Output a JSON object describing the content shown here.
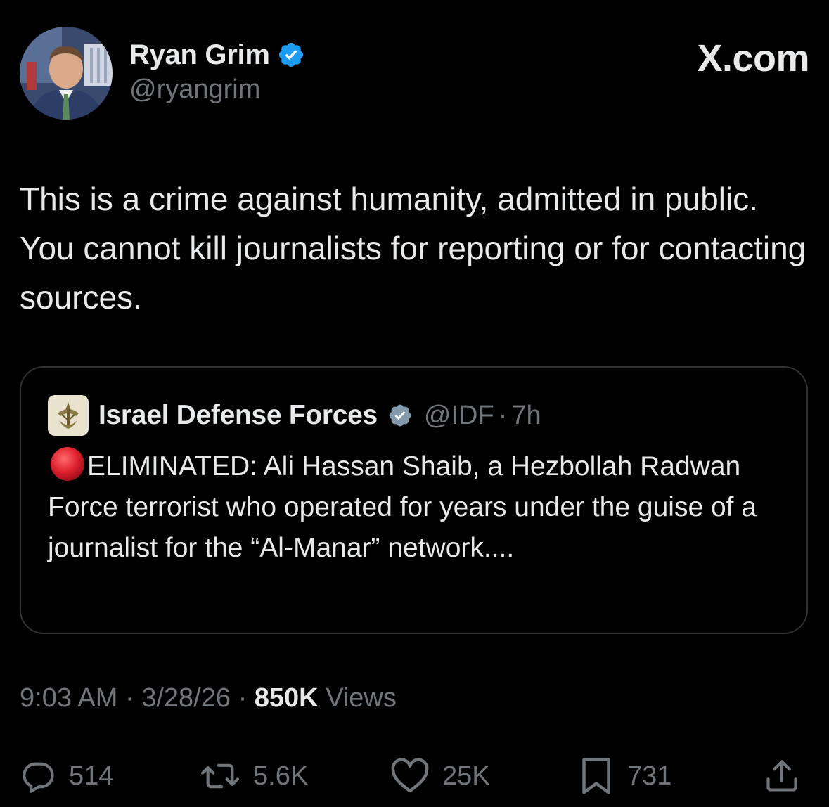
{
  "brand": {
    "label": "X.com"
  },
  "author": {
    "name": "Ryan Grim",
    "handle": "@ryangrim",
    "verified": true,
    "verified_color": "#1d9bf0"
  },
  "tweet": {
    "text": "This is a crime against humanity, admitted in public. You cannot kill journalists for reporting or for contacting sources."
  },
  "quoted_tweet": {
    "name": "Israel Defense Forces",
    "handle": "@IDF",
    "separator": "·",
    "time": "7h",
    "verified": true,
    "verified_color": "#829aab",
    "text": "ELIMINATED: Ali Hassan Shaib, a Hezbollah Radwan Force terrorist who operated for years under the guise of a journalist for the “Al-Manar” network....",
    "emoji_icon": "red-circle-icon"
  },
  "meta": {
    "time": "9:03 AM",
    "date": "3/28/26",
    "separator": "·",
    "views_count": "850K",
    "views_label": "Views"
  },
  "actions": {
    "replies": "514",
    "reposts": "5.6K",
    "likes": "25K",
    "bookmarks": "731"
  },
  "colors": {
    "background": "#000000",
    "primary_text": "#e7e9ea",
    "secondary_text": "#71767b",
    "border": "#2f3336"
  }
}
